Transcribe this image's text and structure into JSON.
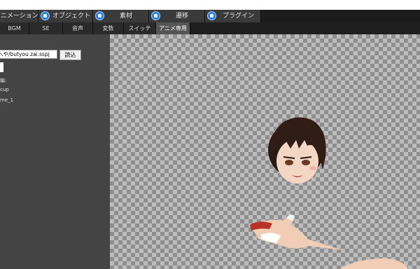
{
  "menu_tabs": [
    {
      "label": "アニメーション",
      "icon": "animation-icon"
    },
    {
      "label": "オブジェクト",
      "icon": "object-icon"
    },
    {
      "label": "素材",
      "icon": "material-icon"
    },
    {
      "label": "遷移",
      "icon": "transition-icon"
    },
    {
      "label": "プラグイン",
      "icon": "plugin-icon"
    }
  ],
  "sub_tabs": [
    "BGM",
    "SE",
    "音声",
    "変数",
    "スイッチ",
    "アニメ専用"
  ],
  "sidebar": {
    "path_value": "へや/butyou zai.sspj",
    "load_button": "読込",
    "label_1": "編:",
    "label_2": "cup",
    "label_3": "me_1"
  },
  "colors": {
    "tab_bg": "#3a3a3a",
    "active_sub_tab": "#555555",
    "sidebar_bg": "#444444",
    "checker_light": "#bdbdbd",
    "checker_dark": "#8f8f8f"
  }
}
